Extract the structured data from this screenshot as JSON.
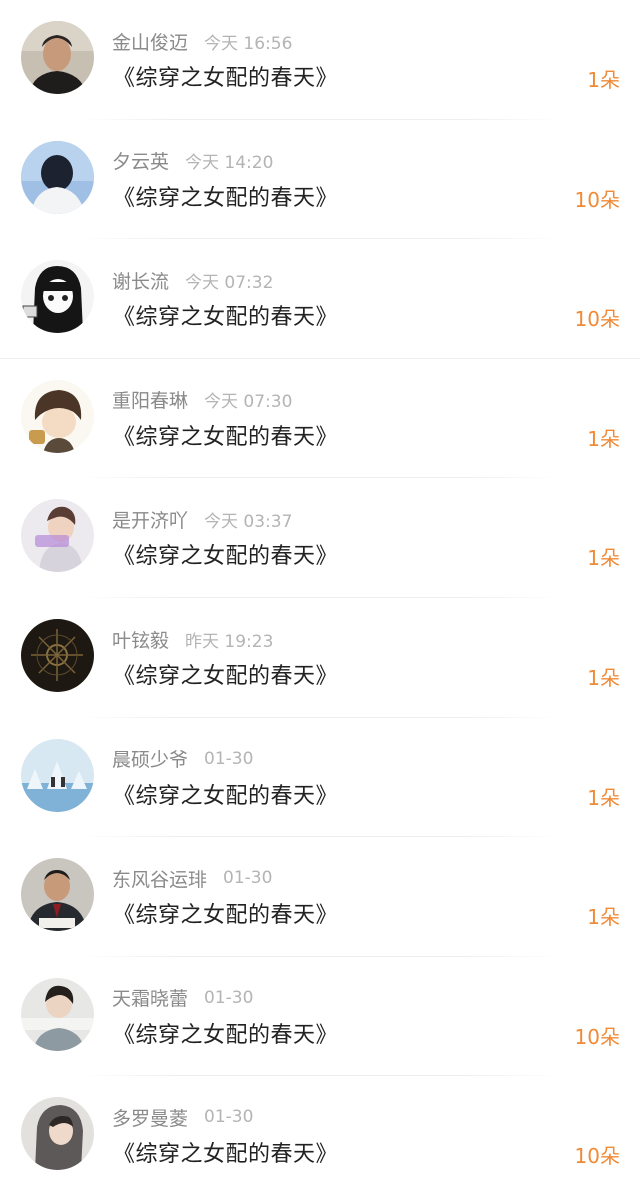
{
  "gift_records": [
    {
      "user": "金山俊迈",
      "time": "今天 16:56",
      "book": "《综穿之女配的春天》",
      "amount": "1朵",
      "avatar": "man-portrait-avatar"
    },
    {
      "user": "夕云英",
      "time": "今天 14:20",
      "book": "《综穿之女配的春天》",
      "amount": "10朵",
      "avatar": "back-view-avatar"
    },
    {
      "user": "谢长流",
      "time": "今天 07:32",
      "book": "《综穿之女配的春天》",
      "amount": "10朵",
      "avatar": "manga-girl-avatar"
    },
    {
      "user": "重阳春琳",
      "time": "今天 07:30",
      "book": "《综穿之女配的春天》",
      "amount": "1朵",
      "avatar": "chibi-character-avatar"
    },
    {
      "user": "是开济吖",
      "time": "今天 03:37",
      "book": "《综穿之女配的春天》",
      "amount": "1朵",
      "avatar": "young-man-avatar"
    },
    {
      "user": "叶铉毅",
      "time": "昨天 19:23",
      "book": "《综穿之女配的春天》",
      "amount": "1朵",
      "avatar": "dark-floral-avatar"
    },
    {
      "user": "晨硕少爷",
      "time": "01-30",
      "book": "《综穿之女配的春天》",
      "amount": "1朵",
      "avatar": "ice-scene-avatar"
    },
    {
      "user": "东风谷运琲",
      "time": "01-30",
      "book": "《综穿之女配的春天》",
      "amount": "1朵",
      "avatar": "official-portrait-avatar"
    },
    {
      "user": "天霜晓蕾",
      "time": "01-30",
      "book": "《综穿之女配的春天》",
      "amount": "10朵",
      "avatar": "boy-caption-avatar"
    },
    {
      "user": "多罗曼菱",
      "time": "01-30",
      "book": "《综穿之女配的春天》",
      "amount": "10朵",
      "avatar": "hooded-figure-avatar"
    }
  ],
  "colors": {
    "amount": "#f08a36",
    "name": "#8a8a8a",
    "time": "#b4b4b4",
    "title": "#222222"
  }
}
